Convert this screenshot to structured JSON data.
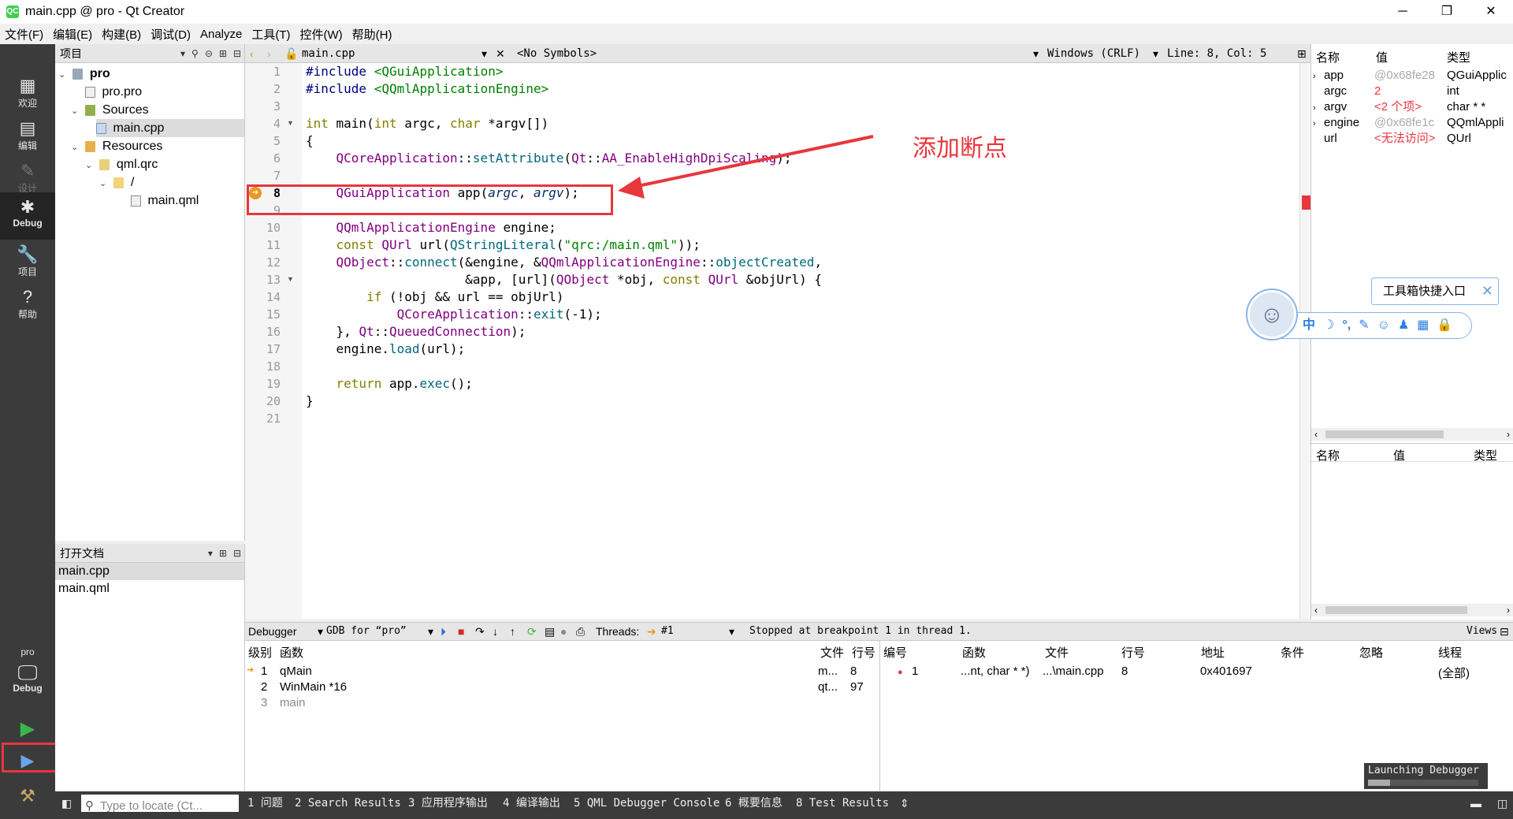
{
  "window": {
    "title": "main.cpp @ pro - Qt Creator",
    "app_icon": "QC",
    "minimize": "─",
    "maximize": "❐",
    "close": "✕"
  },
  "menu": [
    "文件(F)",
    "编辑(E)",
    "构建(B)",
    "调试(D)",
    "Analyze",
    "工具(T)",
    "控件(W)",
    "帮助(H)"
  ],
  "modes": {
    "welcome": "欢迎",
    "edit": "编辑",
    "design": "设计",
    "debug": "Debug",
    "projects": "项目",
    "help": "帮助",
    "kit_project": "pro",
    "kit_mode": "Debug"
  },
  "project_panel": {
    "title": "项目",
    "tree": [
      "pro",
      "pro.pro",
      "Sources",
      "main.cpp",
      "Resources",
      "qml.qrc",
      "/",
      "main.qml"
    ]
  },
  "open_docs": {
    "title": "打开文档",
    "items": [
      "main.cpp",
      "main.qml"
    ]
  },
  "editor_toolbar": {
    "file": "main.cpp",
    "symbols": "<No Symbols>",
    "line_ending": "Windows (CRLF)",
    "position": "Line: 8, Col: 5"
  },
  "code": {
    "line_numbers": [
      "1",
      "2",
      "3",
      "4",
      "5",
      "6",
      "7",
      "8",
      "9",
      "10",
      "11",
      "12",
      "13",
      "14",
      "15",
      "16",
      "17",
      "18",
      "19",
      "20",
      "21"
    ],
    "current_line": "8"
  },
  "annotation": {
    "label": "添加断点",
    "color": "#e8363d"
  },
  "locals": {
    "headers": [
      "名称",
      "值",
      "类型"
    ],
    "rows": [
      {
        "name": "app",
        "value": "@0x68fe28",
        "type": "QGuiApplic"
      },
      {
        "name": "argc",
        "value": "2",
        "type": "int"
      },
      {
        "name": "argv",
        "value": "<2 个项>",
        "type": "char * *"
      },
      {
        "name": "engine",
        "value": "@0x68fe1c",
        "type": "QQmlAppli"
      },
      {
        "name": "url",
        "value": "<无法访问>",
        "type": "QUrl"
      }
    ],
    "headers2": [
      "名称",
      "值",
      "类型"
    ]
  },
  "toolbox": {
    "tip": "工具箱快捷入口",
    "close": "✕",
    "items": [
      "中",
      "☽",
      "°,",
      "✎",
      "☺",
      "♟",
      "▦",
      "🔒"
    ]
  },
  "debugger_toolbar": {
    "view": "Debugger",
    "engine": "GDB for “pro”",
    "threads_label": "Threads:",
    "thread": "#1",
    "status": "Stopped at breakpoint 1 in thread 1.",
    "views": "Views"
  },
  "stack": {
    "headers": [
      "级别",
      "函数",
      "文件",
      "行号"
    ],
    "rows": [
      {
        "level": "1",
        "func": "qMain",
        "file": "m...",
        "line": "8"
      },
      {
        "level": "2",
        "func": "WinMain *16",
        "file": "qt...",
        "line": "97"
      },
      {
        "level": "3",
        "func": "main",
        "file": "",
        "line": ""
      }
    ]
  },
  "breakpoints": {
    "headers": [
      "编号",
      "函数",
      "文件",
      "行号",
      "地址",
      "条件",
      "忽略",
      "线程"
    ],
    "rows": [
      {
        "num": "1",
        "func": "...nt, char * *)",
        "file": "...\\main.cpp",
        "line": "8",
        "addr": "0x401697",
        "cond": "",
        "ignore": "",
        "thread": "(全部)"
      }
    ]
  },
  "statusbar": {
    "locate_placeholder": "Type to locate (Ct...",
    "tabs": [
      "1 问题",
      "2 Search Results",
      "3 应用程序输出",
      "4 编译输出",
      "5 QML Debugger Console",
      "6 概要信息",
      "8 Test Results"
    ]
  },
  "launching": {
    "label": "Launching Debugger",
    "progress": 0.2
  }
}
